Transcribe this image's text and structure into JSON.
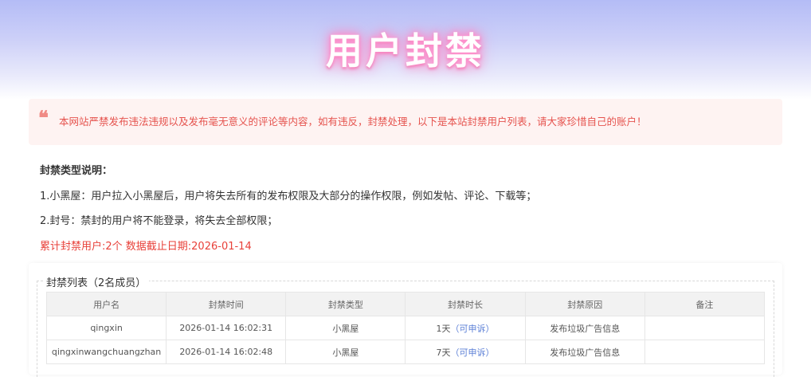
{
  "hero": {
    "title": "用户封禁"
  },
  "notice": {
    "icon": "quote-icon",
    "text": "本网站严禁发布违法违规以及发布毫无意义的评论等内容，如有违反，封禁处理，以下是本站封禁用户列表，请大家珍惜自己的账户！"
  },
  "description": {
    "title": "封禁类型说明：",
    "items": [
      "1.小黑屋：用户拉入小黑屋后，用户将失去所有的发布权限及大部分的操作权限，例如发帖、评论、下载等；",
      "2.封号：禁封的用户将不能登录，将失去全部权限；"
    ]
  },
  "stats": {
    "text": "累计封禁用户:2个 数据截止日期:2026-01-14"
  },
  "ban_list": {
    "legend": "封禁列表（2名成员）",
    "columns": [
      "用户名",
      "封禁时间",
      "封禁类型",
      "封禁时长",
      "封禁原因",
      "备注"
    ],
    "rows": [
      {
        "username": "qingxin",
        "time": "2026-01-14 16:02:31",
        "type": "小黑屋",
        "duration": "1天",
        "appeal": "（可申诉）",
        "reason": "发布垃圾广告信息",
        "note": ""
      },
      {
        "username": "qingxinwangchuangzhan",
        "time": "2026-01-14 16:02:48",
        "type": "小黑屋",
        "duration": "7天",
        "appeal": "（可申诉）",
        "reason": "发布垃圾广告信息",
        "note": ""
      }
    ]
  },
  "colors": {
    "hero_gradient_top": "#b4bcf6",
    "title_glow": "#ff86c8",
    "notice_bg": "#fef3f2",
    "notice_text": "#e6544f",
    "stats_text": "#e8413a",
    "username": "#2e9a5e",
    "appeal_link": "#5b7fd6"
  }
}
